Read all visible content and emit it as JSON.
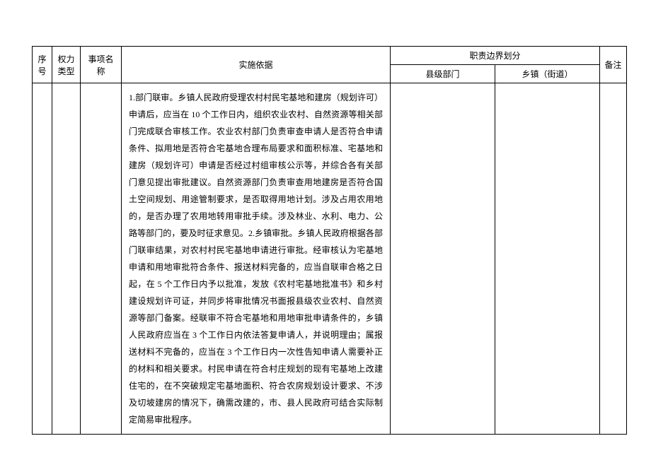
{
  "header": {
    "seq": "序号",
    "type": "权力类型",
    "name": "事项名称",
    "basis": "实施依据",
    "boundary": "职责边界划分",
    "county": "县级部门",
    "town": "乡镇（街道）",
    "remark": "备注"
  },
  "row": {
    "seq": "",
    "type": "",
    "name": "",
    "basis": "1.部门联审。乡镇人民政府受理农村村民宅基地和建房（规划许可）申请后，应当在 10 个工作日内，组织农业农村、自然资源等相关部门完成联合审核工作。农业农村部门负责审查申请人是否符合申请条件、拟用地是否符合宅基地合理布局要求和面积标准、宅基地和建房（规划许可）申请是否经过村组审核公示等，并综合各有关部门意见提出审批建议。自然资源部门负责审查用地建房是否符合国土空间规划、用途管制要求，是否取得用地计划。涉及占用农用地的，是否办理了农用地转用审批手续。涉及林业、水利、电力、公路等部门的，要及时征求意见。2.乡镇审批。乡镇人民政府根据各部门联审结果，对农村村民宅基地申请进行审批。经审核认为宅基地申请和用地审批符合条件、报送材料完备的，应当自联审合格之日起，在 5 个工作日内予以批准，发放《农村宅基地批准书》和乡村建设规划许可证，并同步将审批情况书面报县级农业农村、自然资源等部门备案。经联审不符合宅基地和用地审批申请条件的，乡镇人民政府应当在 3 个工作日内依法答复申请人，并说明理由；属报送材料不完备的，应当在 3 个工作日内一次性告知申请人需要补正的材料和相关要求。村民申请在符合村庄规划的现有宅基地上改建住宅的，在不突破规定宅基地面积、符合农房规划设计要求、不涉及切坡建房的情况下，确需改建的，市、县人民政府可结合实际制定简易审批程序。",
    "county": "",
    "town": "",
    "remark": ""
  }
}
